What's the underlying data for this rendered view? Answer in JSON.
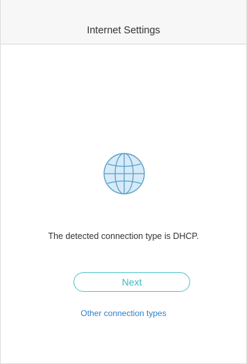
{
  "header": {
    "title": "Internet Settings"
  },
  "main": {
    "icon": "globe-icon",
    "message": "The detected connection type is DHCP.",
    "next_label": "Next",
    "other_link_label": "Other connection types"
  },
  "colors": {
    "accent": "#4cc4c9",
    "globe_fill": "#d6eaf8",
    "globe_stroke": "#5b9fc7",
    "link": "#2f80c9",
    "header_bg": "#f7f7f7"
  }
}
